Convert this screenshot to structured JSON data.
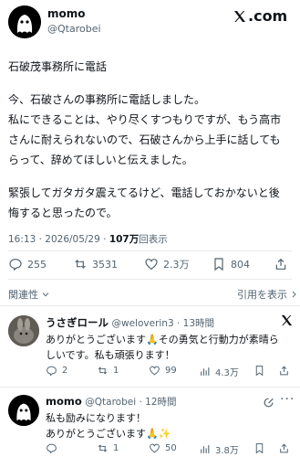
{
  "header": {
    "name": "momo",
    "handle": "@Qtarobei",
    "brand": "𝕏.com"
  },
  "tweet": {
    "line1": "石破茂事務所に電話",
    "para2": "今、石破さんの事務所に電話しました。",
    "para3a": "私にできることは、やり尽くすつもりですが、もう高市",
    "para3b": "さんに耐えられないので、石破さんから上手に話しても",
    "para3c": "らって、辞めてほしいと伝えました。",
    "para4a": "緊張してガタガタ震えてるけど、電話しておかないと後",
    "para4b": "悔すると思ったので。",
    "time": "16:13 · 2026/05/29 · ",
    "views_count": "107万",
    "views_label": "回表示"
  },
  "stats": {
    "replies": "255",
    "retweets": "3531",
    "likes": "2.3万",
    "bookmarks": "804"
  },
  "sort": {
    "left": "関連性",
    "right": "引用を表示"
  },
  "reply1": {
    "name": "うさぎロール",
    "handle": "@weloverin3 · 13時間",
    "text1": "ありがとうございます🙏その勇気と行動力が素晴ら",
    "text2": "しいです。私も頑張ります！",
    "replies": "2",
    "retweets": "1",
    "likes": "99",
    "views": "4.3万"
  },
  "reply2": {
    "name": "momo",
    "handle": "@Qtarobei · 12時間",
    "text1": "私も励みになります！",
    "text2": "ありがとうございます🙏✨",
    "replies": "",
    "retweets": "1",
    "likes": "50",
    "views": "3.8万"
  }
}
